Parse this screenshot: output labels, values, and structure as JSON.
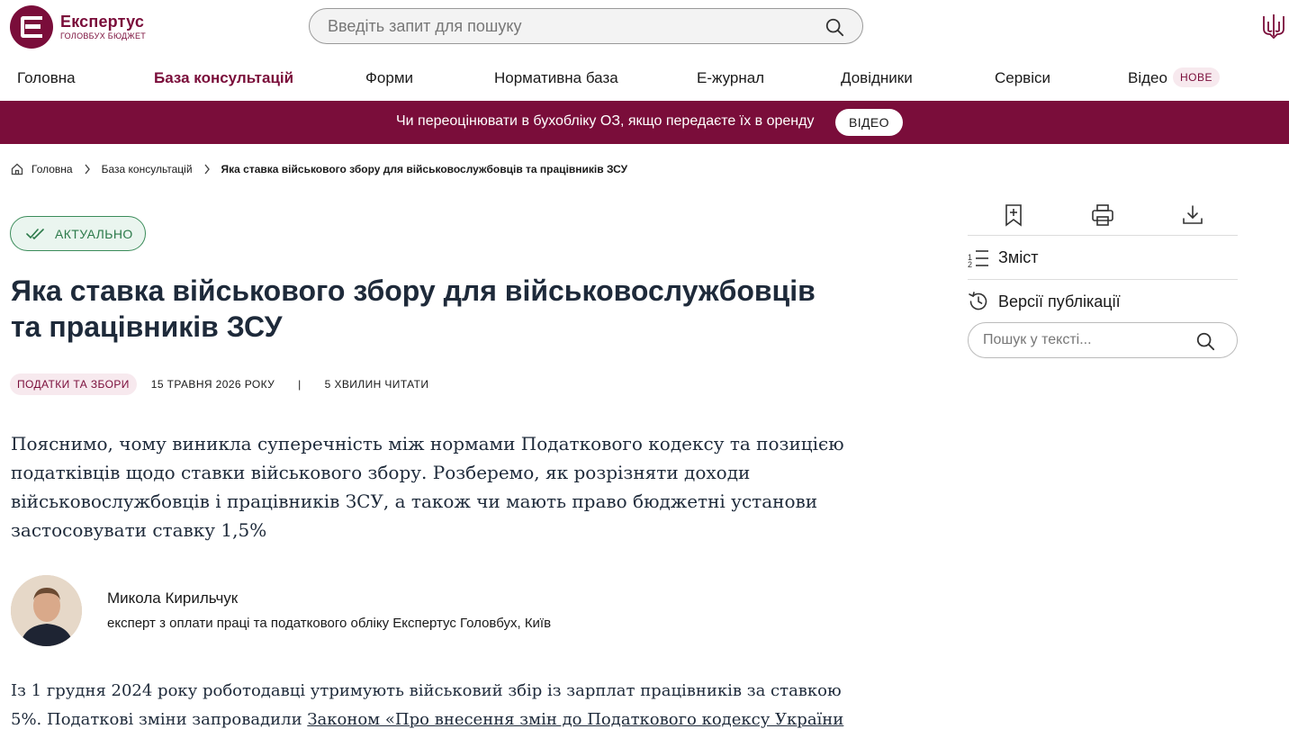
{
  "brand": {
    "name": "Експертус",
    "subtitle": "ГОЛОВБУХ БЮДЖЕТ"
  },
  "search": {
    "placeholder": "Введіть запит для пошуку"
  },
  "nav": {
    "items": [
      {
        "label": "Головна"
      },
      {
        "label": "База консультацій",
        "active": true
      },
      {
        "label": "Форми"
      },
      {
        "label": "Нормативна база"
      },
      {
        "label": "Е-журнал"
      },
      {
        "label": "Довідники"
      },
      {
        "label": "Сервіси"
      },
      {
        "label": "Відео"
      }
    ],
    "badge": "НОВЕ"
  },
  "promo": {
    "text": "Чи переоцінювати в бухобліку ОЗ, якщо передаєте їх в оренду",
    "button": "ВІДЕО"
  },
  "breadcrumb": {
    "home": "Головна",
    "section": "База консультацій",
    "current": "Яка ставка військового збору для військовослужбовців та працівників ЗСУ"
  },
  "article": {
    "status": "АКТУАЛЬНО",
    "title": "Яка ставка військового збору для військовослужбовців та працівників ЗСУ",
    "tag": "ПОДАТКИ ТА ЗБОРИ",
    "date": "15 ТРАВНЯ 2026 РОКУ",
    "separator": "|",
    "read_time": "5 ХВИЛИН ЧИТАТИ",
    "lead": "Пояснимо, чому виникла суперечність між нормами Податкового кодексу та позицією податківців щодо ставки військового збору. Розберемо, як розрізняти доходи військовослужбовців і працівників ЗСУ, а також чи мають право бюджетні установи застосовувати ставку 1,5%",
    "author": {
      "name": "Микола Кирильчук",
      "role": "експерт з оплати праці та податкового обліку Експертус Головбух, Київ"
    },
    "body_intro": "Із 1 грудня 2024 року роботодавці утримують військовий збір із зарплат працівників за ставкою 5%. Податкові зміни запровадили ",
    "body_link": "Законом «Про внесення змін до Податкового кодексу України"
  },
  "sidebar": {
    "toc": "Зміст",
    "versions": "Версії публікації",
    "search_placeholder": "Пошук у тексті..."
  },
  "colors": {
    "brand": "#7a0d3a",
    "status_green": "#2c7a4a",
    "title": "#1e2a3a"
  }
}
